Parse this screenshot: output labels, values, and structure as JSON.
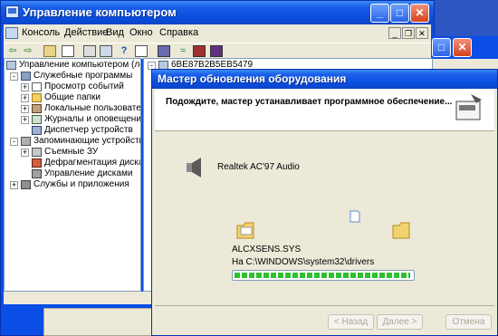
{
  "main_window": {
    "title": "Управление компьютером",
    "menu": [
      "Консоль",
      "Действие",
      "Вид",
      "Окно",
      "Справка"
    ],
    "tree": [
      {
        "label": "Управление компьютером (локаль",
        "expander": ""
      },
      {
        "label": "Служебные программы",
        "expander": "-"
      },
      {
        "label": "Просмотр событий",
        "expander": "+"
      },
      {
        "label": "Общие папки",
        "expander": "+"
      },
      {
        "label": "Локальные пользователи",
        "expander": "+"
      },
      {
        "label": "Журналы и оповещения п",
        "expander": "+"
      },
      {
        "label": "Диспетчер устройств",
        "expander": ""
      },
      {
        "label": "Запоминающие устройства",
        "expander": "-"
      },
      {
        "label": "Съемные ЗУ",
        "expander": "+"
      },
      {
        "label": "Дефрагментация диска",
        "expander": ""
      },
      {
        "label": "Управление дисками",
        "expander": ""
      },
      {
        "label": "Службы и приложения",
        "expander": "+"
      }
    ],
    "right_pane_item": "6BE87B2B5EB5479"
  },
  "wizard": {
    "title": "Мастер обновления оборудования",
    "header_text": "Подождите, мастер устанавливает программное обеспечение...",
    "device_name": "Realtek AC'97 Audio",
    "file_name": "ALCXSENS.SYS",
    "destination": "На C:\\WINDOWS\\system32\\drivers",
    "progress_fraction": 0.99,
    "back_label": "< Назад",
    "next_label": "Далее >",
    "cancel_label": "Отмена"
  }
}
